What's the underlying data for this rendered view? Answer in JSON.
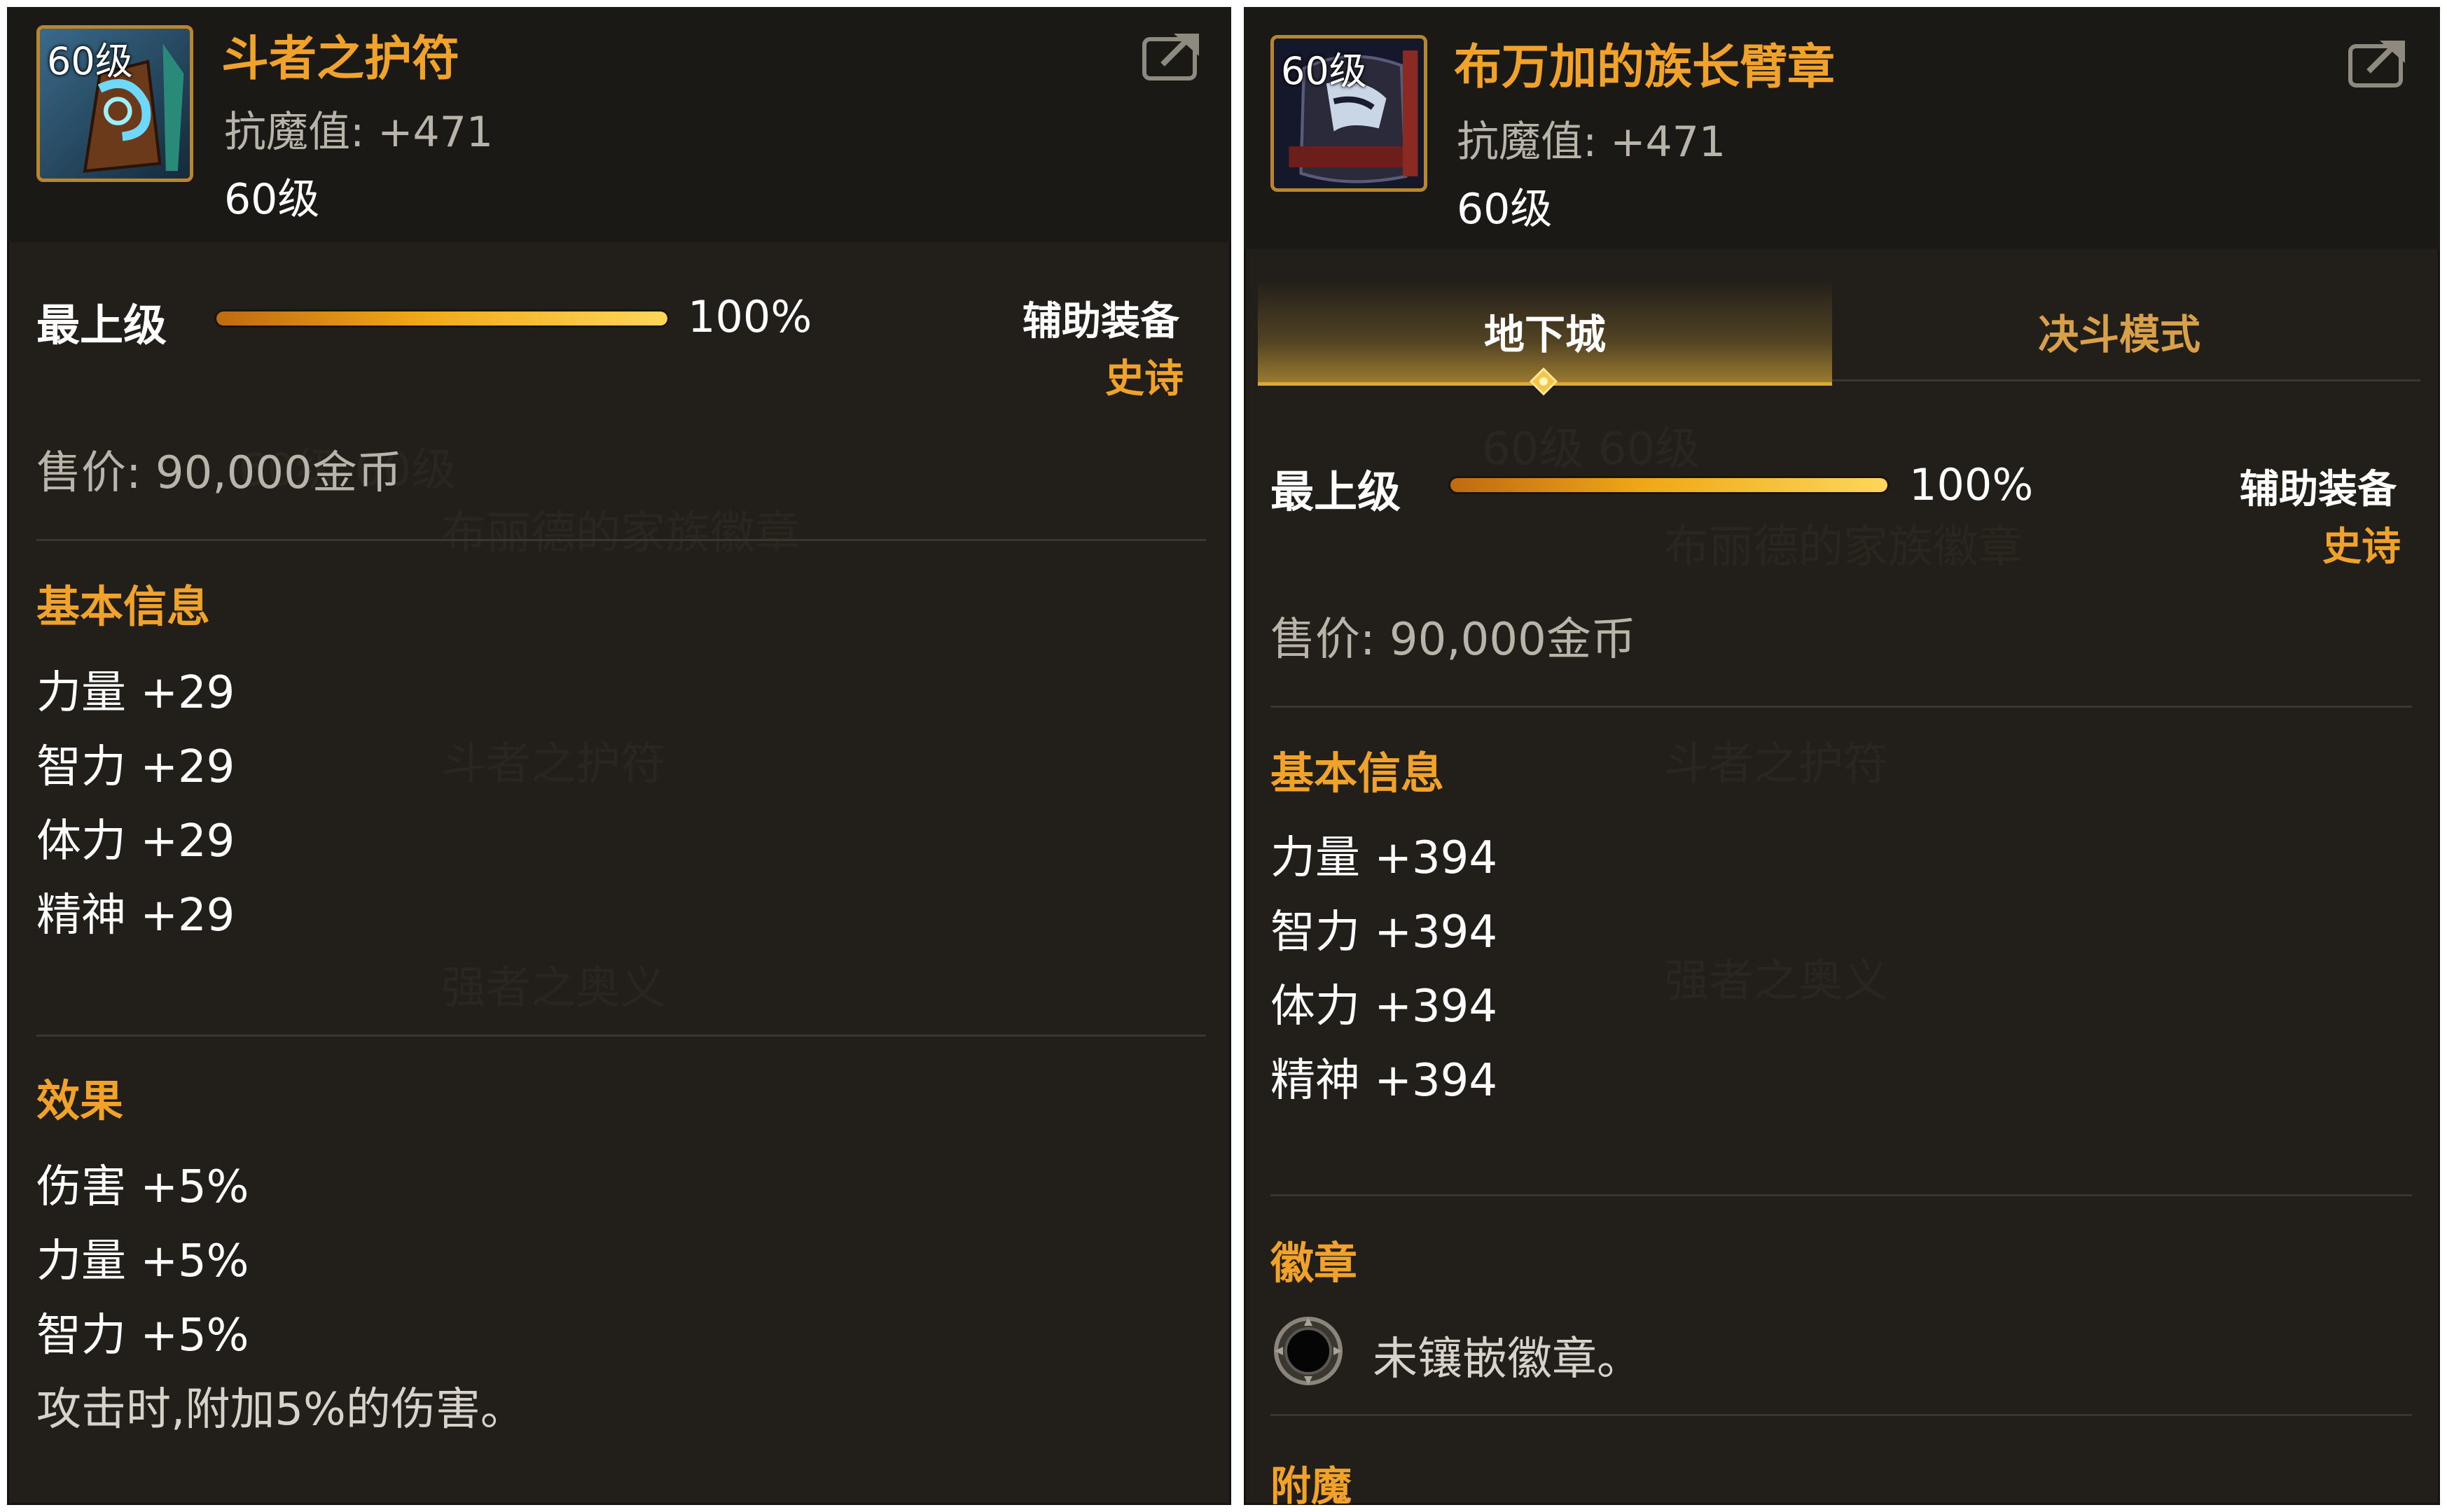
{
  "left_item": {
    "icon_level": "60级",
    "name": "斗者之护符",
    "anti_magic": "抗魔值: +471",
    "level": "60级",
    "grade_label": "最上级",
    "grade_percent": "100%",
    "grade_fill": 1.0,
    "item_type": "辅助装备",
    "rarity": "史诗",
    "price": "售价: 90,000金币",
    "basic_info_title": "基本信息",
    "basic_stats": [
      "力量 +29",
      "智力 +29",
      "体力 +29",
      "精神 +29"
    ],
    "effect_title": "效果",
    "effects": [
      "伤害 +5%",
      "力量 +5%",
      "智力 +5%"
    ],
    "effect_desc": "攻击时,附加5%的伤害。"
  },
  "right_item": {
    "icon_level": "60级",
    "name": "布万加的族长臂章",
    "anti_magic": "抗魔值: +471",
    "level": "60级",
    "tabs": [
      "地下城",
      "决斗模式"
    ],
    "active_tab": "地下城",
    "grade_label": "最上级",
    "grade_percent": "100%",
    "grade_fill": 1.0,
    "item_type": "辅助装备",
    "rarity": "史诗",
    "price": "售价: 90,000金币",
    "basic_info_title": "基本信息",
    "basic_stats": [
      "力量 +394",
      "智力 +394",
      "体力 +394",
      "精神 +394"
    ],
    "emblem_title": "徽章",
    "emblem_empty": "未镶嵌徽章。",
    "enchant_title": "附魔"
  },
  "colors": {
    "panel_bg": "#221f1a",
    "header_bg": "#1b1915",
    "accent_gold": "#f0a22a",
    "stat_gray": "#b9b4aa"
  },
  "icons": [
    "share-icon",
    "item-icon",
    "emblem-slot-icon",
    "tab-marker-icon"
  ]
}
